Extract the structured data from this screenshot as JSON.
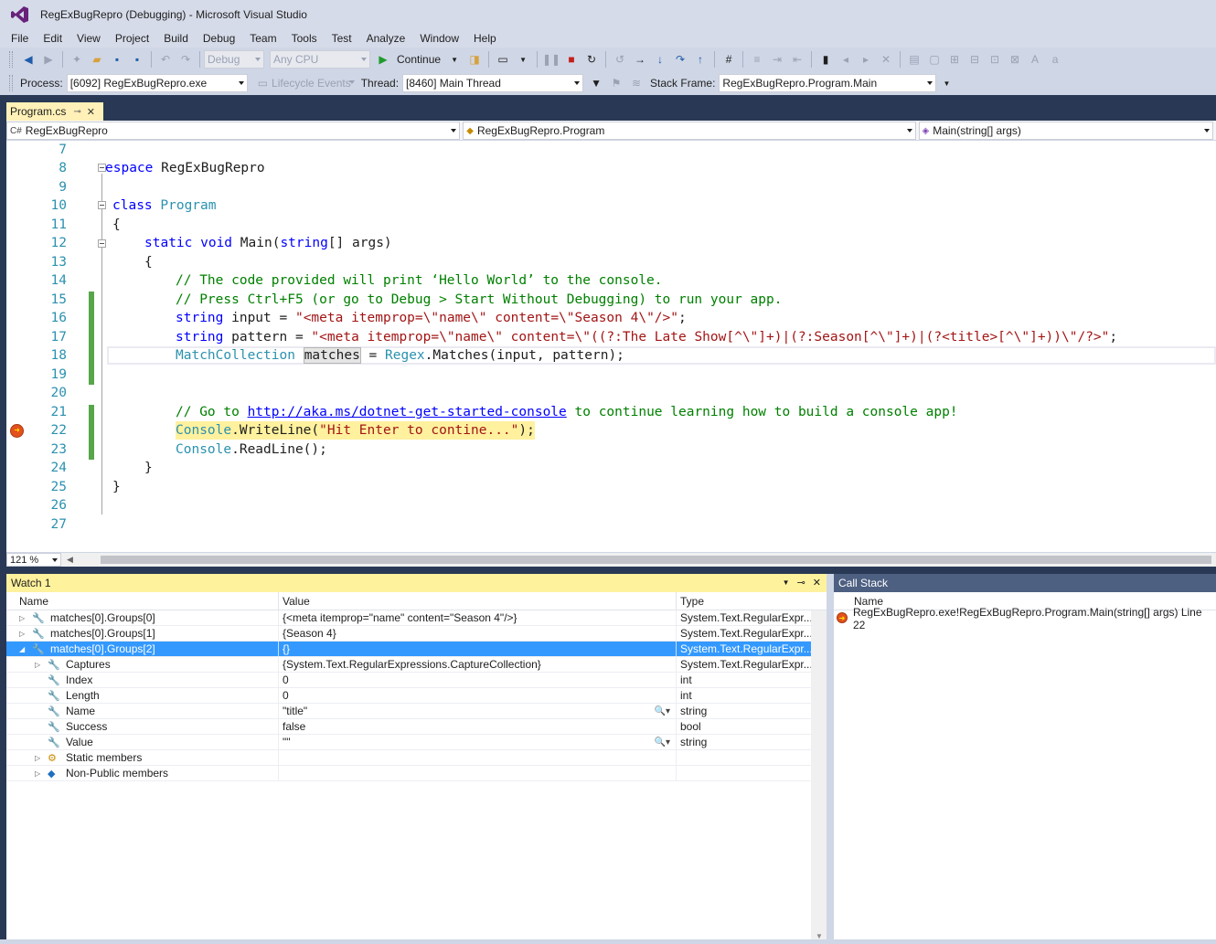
{
  "window": {
    "title": "RegExBugRepro (Debugging) - Microsoft Visual Studio"
  },
  "menu": [
    "File",
    "Edit",
    "View",
    "Project",
    "Build",
    "Debug",
    "Team",
    "Tools",
    "Test",
    "Analyze",
    "Window",
    "Help"
  ],
  "toolbar": {
    "config": "Debug",
    "platform": "Any CPU",
    "continue_label": "Continue",
    "process_label": "Process:",
    "process_value": "[6092] RegExBugRepro.exe",
    "lifecycle_label": "Lifecycle Events",
    "thread_label": "Thread:",
    "thread_value": "[8460] Main Thread",
    "stackframe_label": "Stack Frame:",
    "stackframe_value": "RegExBugRepro.Program.Main"
  },
  "editor": {
    "tab": "Program.cs",
    "nav_project": "RegExBugRepro",
    "nav_class": "RegExBugRepro.Program",
    "nav_member": "Main(string[] args)",
    "zoom": "121 %",
    "lines": [
      {
        "n": "7"
      },
      {
        "n": "8",
        "t1": "espace",
        "t2": " RegExBugRepro"
      },
      {
        "n": "9"
      },
      {
        "n": "10",
        "t1": "class",
        "t2": " Program"
      },
      {
        "n": "11",
        "t1": "{"
      },
      {
        "n": "12",
        "t1": "static",
        "t2": " void",
        "t3": " Main(",
        "t4": "string",
        "t5": "[] args)"
      },
      {
        "n": "13",
        "t1": "{"
      },
      {
        "n": "14",
        "t1": "// The code provided will print ‘Hello World’ to the console."
      },
      {
        "n": "15",
        "t1": "// Press Ctrl+F5 (or go to Debug > Start Without Debugging) to run your app."
      },
      {
        "n": "16",
        "t1": "string",
        "t2": " input = ",
        "t3": "\"<meta itemprop=\\\"name\\\" content=\\\"Season 4\\\"/>\"",
        "t4": ";"
      },
      {
        "n": "17",
        "t1": "string",
        "t2": " pattern = ",
        "t3": "\"<meta itemprop=\\\"name\\\" content=\\\"((?:The Late Show[^\\\"]+)|(?:Season[^\\\"]+)|(?<title>[^\\\"]+))\\\"/?>\"",
        "t4": ";"
      },
      {
        "n": "18",
        "t1": "MatchCollection",
        "t2": " ",
        "t3": "matches",
        "t4": " = ",
        "t5": "Regex",
        "t6": ".Matches(input, pattern);"
      },
      {
        "n": "19"
      },
      {
        "n": "20"
      },
      {
        "n": "21",
        "t1": "// Go to ",
        "t2": "http://aka.ms/dotnet-get-started-console",
        "t3": " to continue learning how to build a console app!"
      },
      {
        "n": "22",
        "t1": "Console",
        "t2": ".WriteLine(",
        "t3": "\"Hit Enter to contine...\"",
        "t4": ");"
      },
      {
        "n": "23",
        "t1": "Console",
        "t2": ".ReadLine();"
      },
      {
        "n": "24",
        "t1": "}"
      },
      {
        "n": "25",
        "t1": "}"
      },
      {
        "n": "26"
      },
      {
        "n": "27"
      }
    ]
  },
  "watch": {
    "title": "Watch 1",
    "columns": [
      "Name",
      "Value",
      "Type"
    ],
    "rows": [
      {
        "name": "matches[0].Groups[0]",
        "value": "{<meta itemprop=\"name\" content=\"Season 4\"/>}",
        "type": "System.Text.RegularExpr..."
      },
      {
        "name": "matches[0].Groups[1]",
        "value": "{Season 4}",
        "type": "System.Text.RegularExpr..."
      },
      {
        "name": "matches[0].Groups[2]",
        "value": "{}",
        "type": "System.Text.RegularExpr..."
      },
      {
        "name": "Captures",
        "value": "{System.Text.RegularExpressions.CaptureCollection}",
        "type": "System.Text.RegularExpr..."
      },
      {
        "name": "Index",
        "value": "0",
        "type": "int"
      },
      {
        "name": "Length",
        "value": "0",
        "type": "int"
      },
      {
        "name": "Name",
        "value": "\"title\"",
        "type": "string"
      },
      {
        "name": "Success",
        "value": "false",
        "type": "bool"
      },
      {
        "name": "Value",
        "value": "\"\"",
        "type": "string"
      },
      {
        "name": "Static members",
        "value": "",
        "type": ""
      },
      {
        "name": "Non-Public members",
        "value": "",
        "type": ""
      }
    ]
  },
  "callstack": {
    "title": "Call Stack",
    "column": "Name",
    "frame": "RegExBugRepro.exe!RegExBugRepro.Program.Main(string[] args) Line 22"
  },
  "colors": {
    "accent": "#293955",
    "active_tab": "#fff1b8",
    "selection": "#3399ff"
  }
}
